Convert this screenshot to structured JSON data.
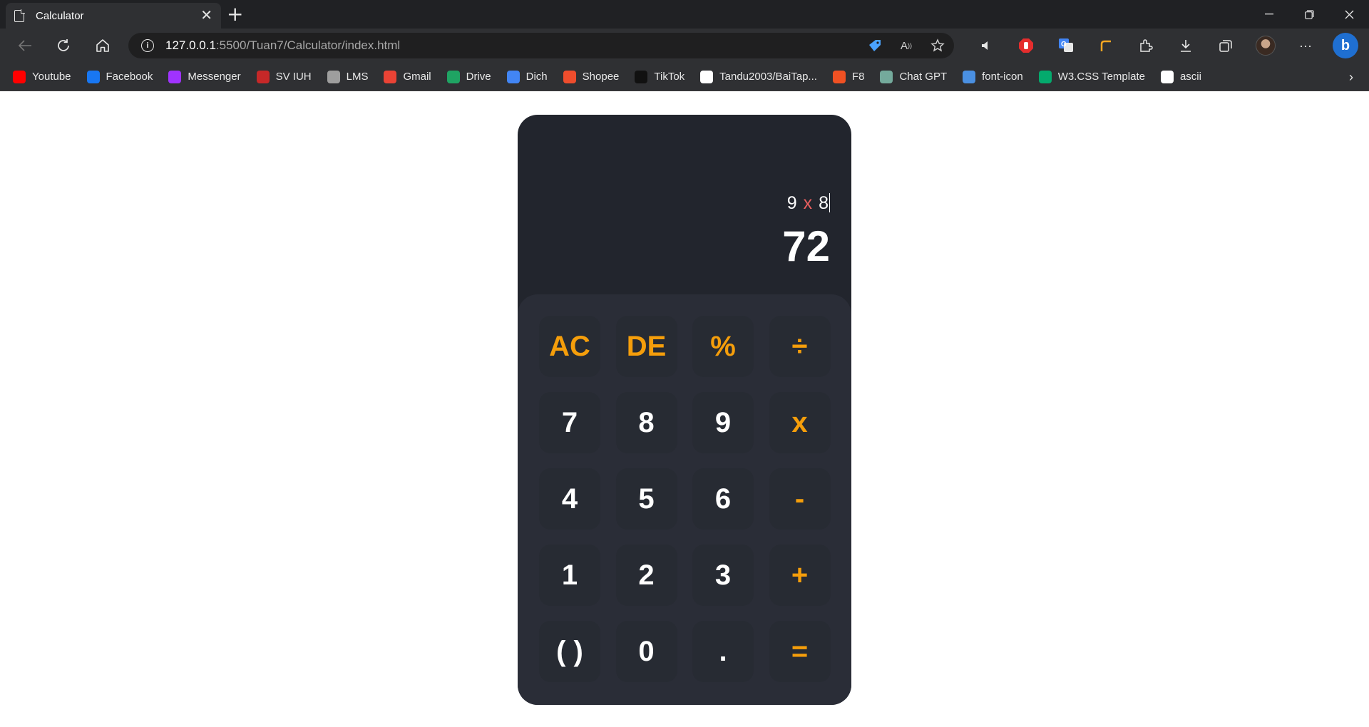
{
  "browser": {
    "tab_title": "Calculator",
    "url_host": "127.0.0.1",
    "url_path": ":5500/Tuan7/Calculator/index.html",
    "bookmarks": [
      {
        "label": "Youtube",
        "icon": "youtube-icon",
        "color": "#ff0000"
      },
      {
        "label": "Facebook",
        "icon": "facebook-icon",
        "color": "#1877f2"
      },
      {
        "label": "Messenger",
        "icon": "messenger-icon",
        "color": "#a033ff"
      },
      {
        "label": "SV IUH",
        "icon": "sv-iuh-icon",
        "color": "#c62828"
      },
      {
        "label": "LMS",
        "icon": "lms-icon",
        "color": "#9e9e9e"
      },
      {
        "label": "Gmail",
        "icon": "gmail-icon",
        "color": "#ea4335"
      },
      {
        "label": "Drive",
        "icon": "drive-icon",
        "color": "#1fa463"
      },
      {
        "label": "Dich",
        "icon": "translate-icon",
        "color": "#4285f4"
      },
      {
        "label": "Shopee",
        "icon": "shopee-icon",
        "color": "#ee4d2d"
      },
      {
        "label": "TikTok",
        "icon": "tiktok-icon",
        "color": "#111111"
      },
      {
        "label": "Tandu2003/BaiTap...",
        "icon": "github-icon",
        "color": "#ffffff"
      },
      {
        "label": "F8",
        "icon": "f8-icon",
        "color": "#f05123"
      },
      {
        "label": "Chat GPT",
        "icon": "chatgpt-icon",
        "color": "#74aa9c"
      },
      {
        "label": "font-icon",
        "icon": "flag-icon",
        "color": "#4a90e2"
      },
      {
        "label": "W3.CSS Template",
        "icon": "w3-icon",
        "color": "#04aa6d"
      },
      {
        "label": "ascii",
        "icon": "ascii-icon",
        "color": "#ffffff"
      }
    ]
  },
  "calculator": {
    "expression": {
      "left": "9",
      "operator": "x",
      "right": "8"
    },
    "result": "72",
    "keys": [
      {
        "label": "AC",
        "type": "op",
        "name": "clear-all-button"
      },
      {
        "label": "DE",
        "type": "op",
        "name": "delete-button"
      },
      {
        "label": "%",
        "type": "op",
        "name": "percent-button"
      },
      {
        "label": "÷",
        "type": "op",
        "name": "divide-button"
      },
      {
        "label": "7",
        "type": "num",
        "name": "digit-7-button"
      },
      {
        "label": "8",
        "type": "num",
        "name": "digit-8-button"
      },
      {
        "label": "9",
        "type": "num",
        "name": "digit-9-button"
      },
      {
        "label": "x",
        "type": "op",
        "name": "multiply-button"
      },
      {
        "label": "4",
        "type": "num",
        "name": "digit-4-button"
      },
      {
        "label": "5",
        "type": "num",
        "name": "digit-5-button"
      },
      {
        "label": "6",
        "type": "num",
        "name": "digit-6-button"
      },
      {
        "label": "-",
        "type": "op",
        "name": "subtract-button"
      },
      {
        "label": "1",
        "type": "num",
        "name": "digit-1-button"
      },
      {
        "label": "2",
        "type": "num",
        "name": "digit-2-button"
      },
      {
        "label": "3",
        "type": "num",
        "name": "digit-3-button"
      },
      {
        "label": "+",
        "type": "op",
        "name": "add-button"
      },
      {
        "label": "( )",
        "type": "num",
        "name": "parentheses-button"
      },
      {
        "label": "0",
        "type": "num",
        "name": "digit-0-button"
      },
      {
        "label": ".",
        "type": "num",
        "name": "decimal-button"
      },
      {
        "label": "=",
        "type": "op",
        "name": "equals-button"
      }
    ],
    "colors": {
      "operator": "#f59e0b",
      "expression_operator": "#ea5f5f",
      "body": "#22252d",
      "keypad": "#2a2d37",
      "key": "#272b33"
    }
  }
}
